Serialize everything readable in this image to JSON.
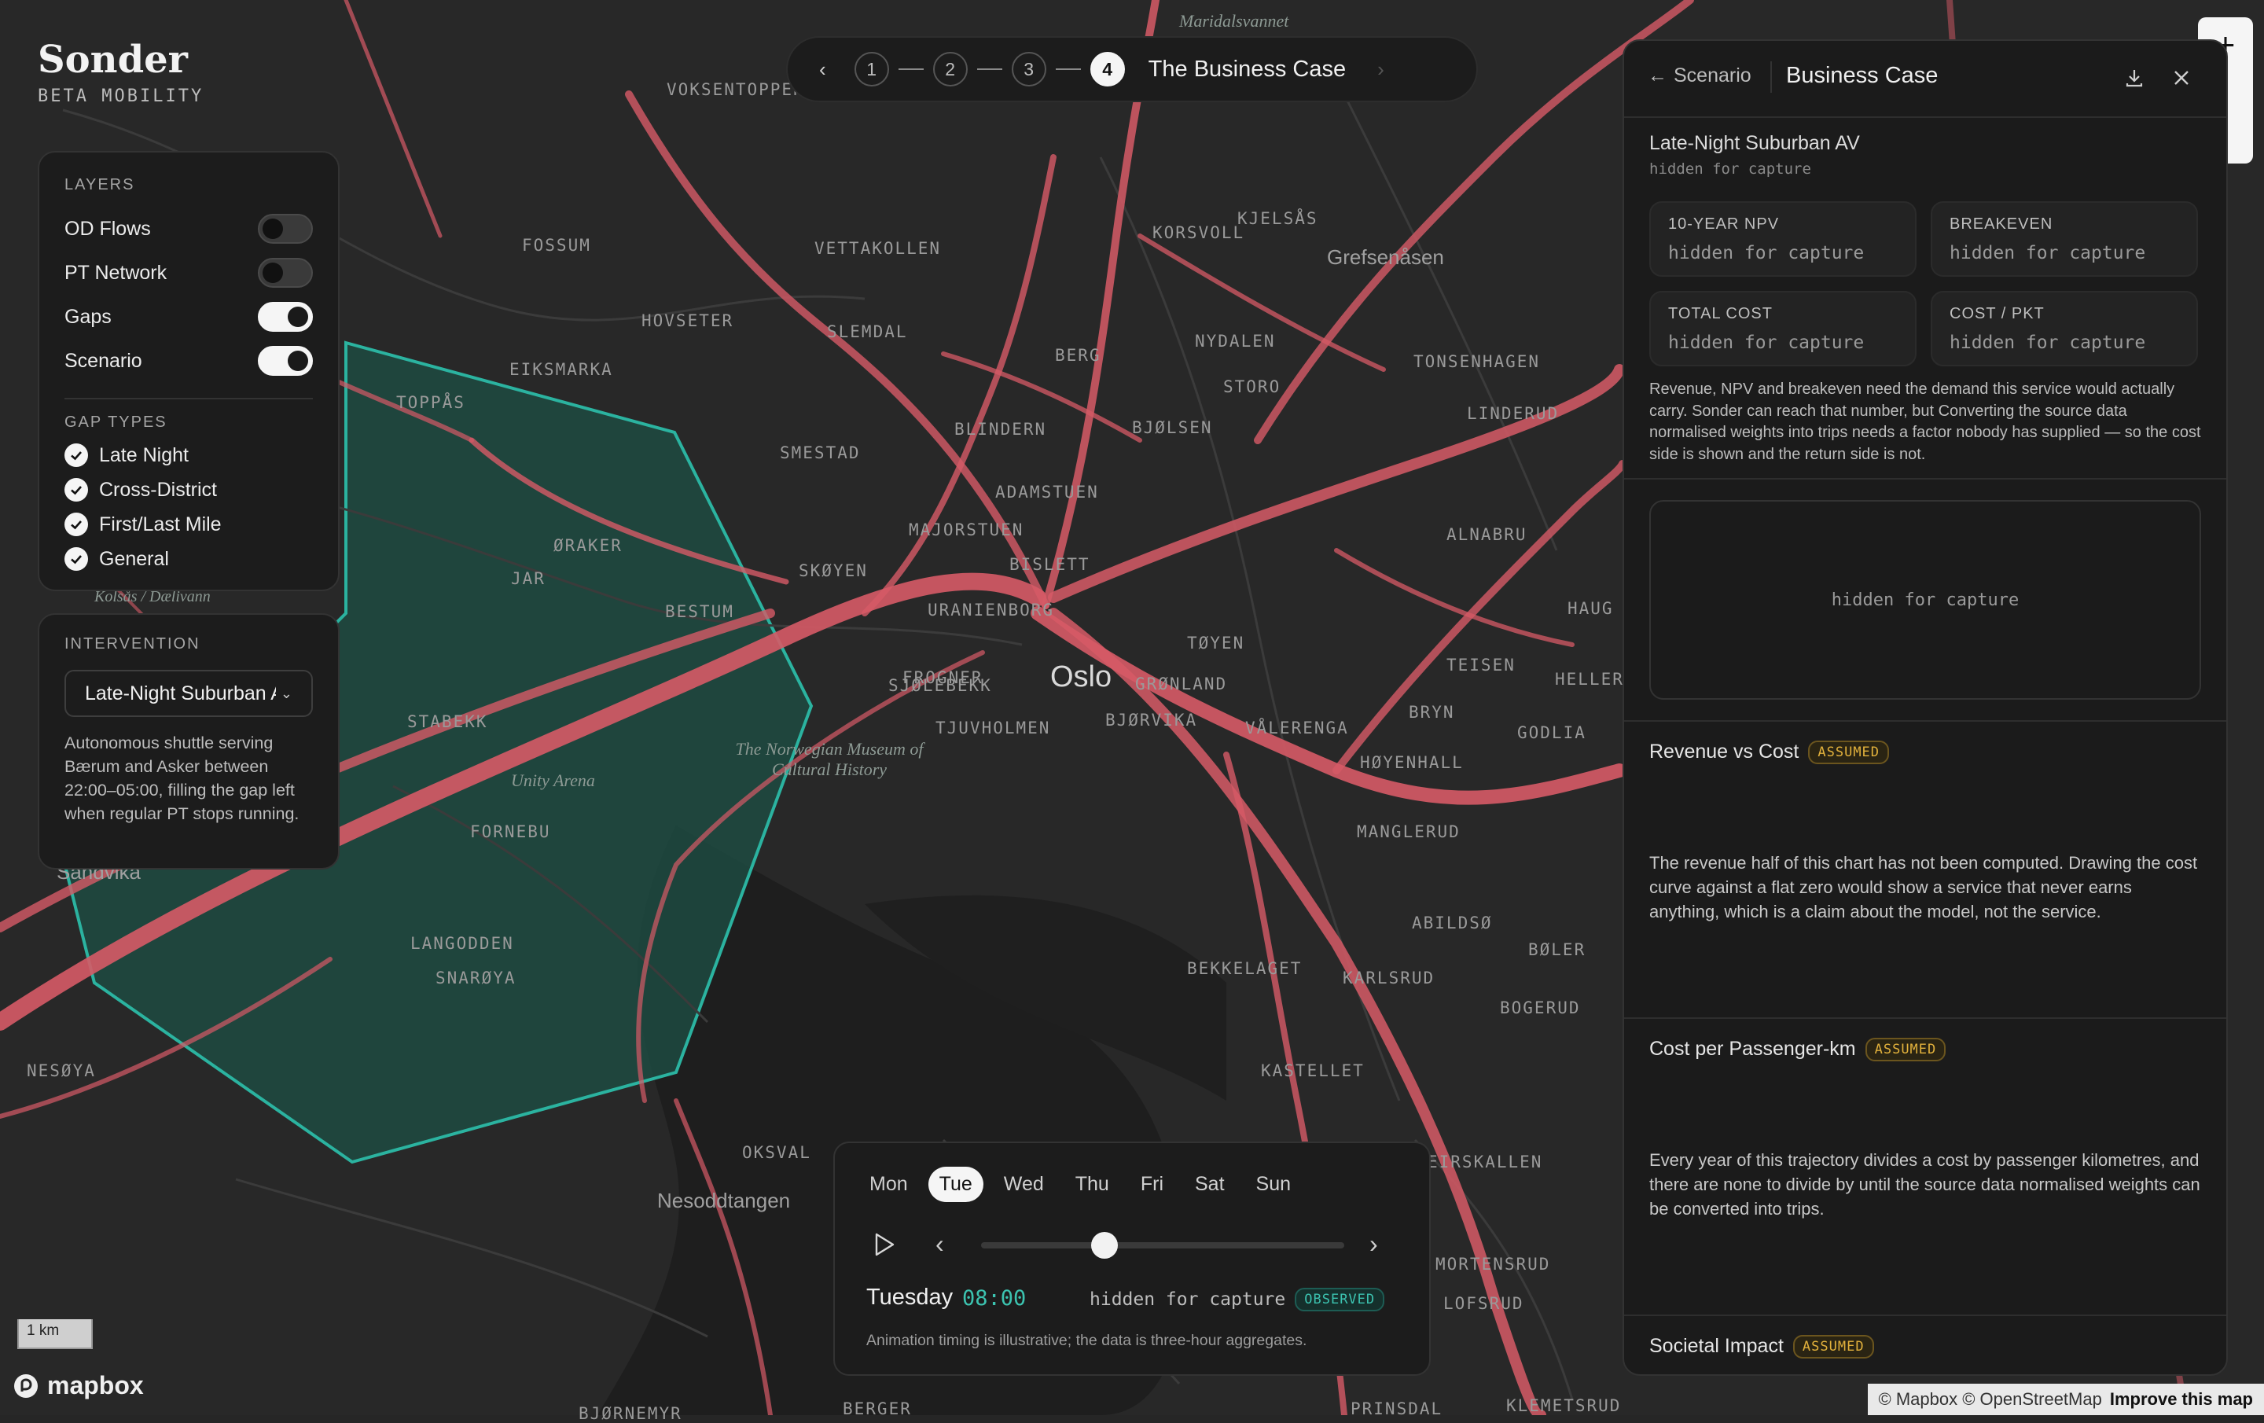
{
  "brand": {
    "name": "Sonder",
    "subtitle": "BETA MOBILITY"
  },
  "layers": {
    "title": "LAYERS",
    "items": [
      {
        "label": "OD Flows",
        "on": false
      },
      {
        "label": "PT Network",
        "on": false
      },
      {
        "label": "Gaps",
        "on": true
      },
      {
        "label": "Scenario",
        "on": true
      }
    ],
    "gap_types_title": "GAP TYPES",
    "gap_types": [
      {
        "label": "Late Night",
        "checked": true
      },
      {
        "label": "Cross-District",
        "checked": true
      },
      {
        "label": "First/Last Mile",
        "checked": true
      },
      {
        "label": "General",
        "checked": true
      }
    ]
  },
  "intervention": {
    "title": "INTERVENTION",
    "selected": "Late-Night Suburban AV",
    "description": "Autonomous shuttle serving Bærum and Asker between 22:00–05:00, filling the gap left when regular PT stops running."
  },
  "stepper": {
    "steps": [
      "1",
      "2",
      "3",
      "4"
    ],
    "active": "4",
    "title": "The Business Case"
  },
  "panel": {
    "back_label": "Scenario",
    "title": "Business Case",
    "scenario_name": "Late-Night Suburban AV",
    "scenario_sub": "hidden for capture",
    "metrics": [
      {
        "label": "10-YEAR NPV",
        "value": "hidden for capture"
      },
      {
        "label": "BREAKEVEN",
        "value": "hidden for capture"
      },
      {
        "label": "TOTAL COST",
        "value": "hidden for capture"
      },
      {
        "label": "COST / PKT",
        "value": "hidden for capture"
      }
    ],
    "note": "Revenue, NPV and breakeven need the demand this service would actually carry. Sonder can reach that number, but Converting the source data normalised weights into trips needs a factor nobody has supplied — so the cost side is shown and the return side is not.",
    "chart_placeholder": "hidden for capture",
    "cards": [
      {
        "title": "Revenue vs Cost",
        "badge": "ASSUMED",
        "text": "The revenue half of this chart has not been computed. Drawing the cost curve against a flat zero would show a service that never earns anything, which is a claim about the model, not the service."
      },
      {
        "title": "Cost per Passenger-km",
        "badge": "ASSUMED",
        "text": "Every year of this trajectory divides a cost by passenger kilometres, and there are none to divide by until the source data normalised weights can be converted into trips."
      },
      {
        "title": "Societal Impact",
        "badge": "ASSUMED",
        "text": ""
      }
    ]
  },
  "timeline": {
    "days": [
      "Mon",
      "Tue",
      "Wed",
      "Thu",
      "Fri",
      "Sat",
      "Sun"
    ],
    "selected_day": "Tue",
    "day_label": "Tuesday",
    "time": "08:00",
    "status": "hidden for capture",
    "badge": "OBSERVED",
    "slider_fraction": 0.34,
    "footnote": "Animation timing is illustrative; the data is three-hour aggregates."
  },
  "map": {
    "places": [
      "Maridalsvannet",
      "VOKSENTOPPEN",
      "KORSVOLL",
      "KJELSÅS",
      "Grefsenåsen",
      "FOSSUM",
      "VETTAKOLLEN",
      "HOVSETER",
      "SLEMDAL",
      "BERG",
      "NYDALEN",
      "TONSENHAGEN",
      "EIKSMARKA",
      "TOPPÅS",
      "LINDERUD",
      "BLINDERN",
      "BJØLSEN",
      "STORO",
      "SMESTAD",
      "ADAMSTUEN",
      "ALNABRU",
      "MAJORSTUEN",
      "ØRAKER",
      "SKØYEN",
      "BISLETT",
      "JAR",
      "URANIENBORG",
      "BESTUM",
      "Kolsås / Dælivann",
      "TØYEN",
      "Oslo",
      "TEISEN",
      "FROGNER",
      "GRØNLAND",
      "SJØLEBEKK",
      "BRYN",
      "BJØRVIKA",
      "TJUVHOLMEN",
      "VÅLERENGA",
      "HØYENHALL",
      "STABEKK",
      "The Norwegian Museum of Cultural History",
      "GODLIA",
      "Unity Arena",
      "MANGLERUD",
      "FORNEBU",
      "Sandvika",
      "ABILDSØ",
      "LANGODDEN",
      "BØLER",
      "BEKKELAGET",
      "KARLSRUD",
      "SNARØYA",
      "BOGERUD",
      "NESØYA",
      "KASTELLET",
      "OKSVAL",
      "Nesoddtangen",
      "EIRSKALLEN",
      "MORTENSRUD",
      "LOFSRUD",
      "BJØRNEMYR",
      "BERGER",
      "PRINSDAL",
      "KLEMETSRUD",
      "HELLER",
      "HAUG"
    ],
    "scale_label": "1 km",
    "attribution": "© Mapbox © OpenStreetMap",
    "improve": "Improve this map",
    "logo": "mapbox",
    "colors": {
      "flow": "#e0606b",
      "gap": "#1f9e8c"
    }
  }
}
